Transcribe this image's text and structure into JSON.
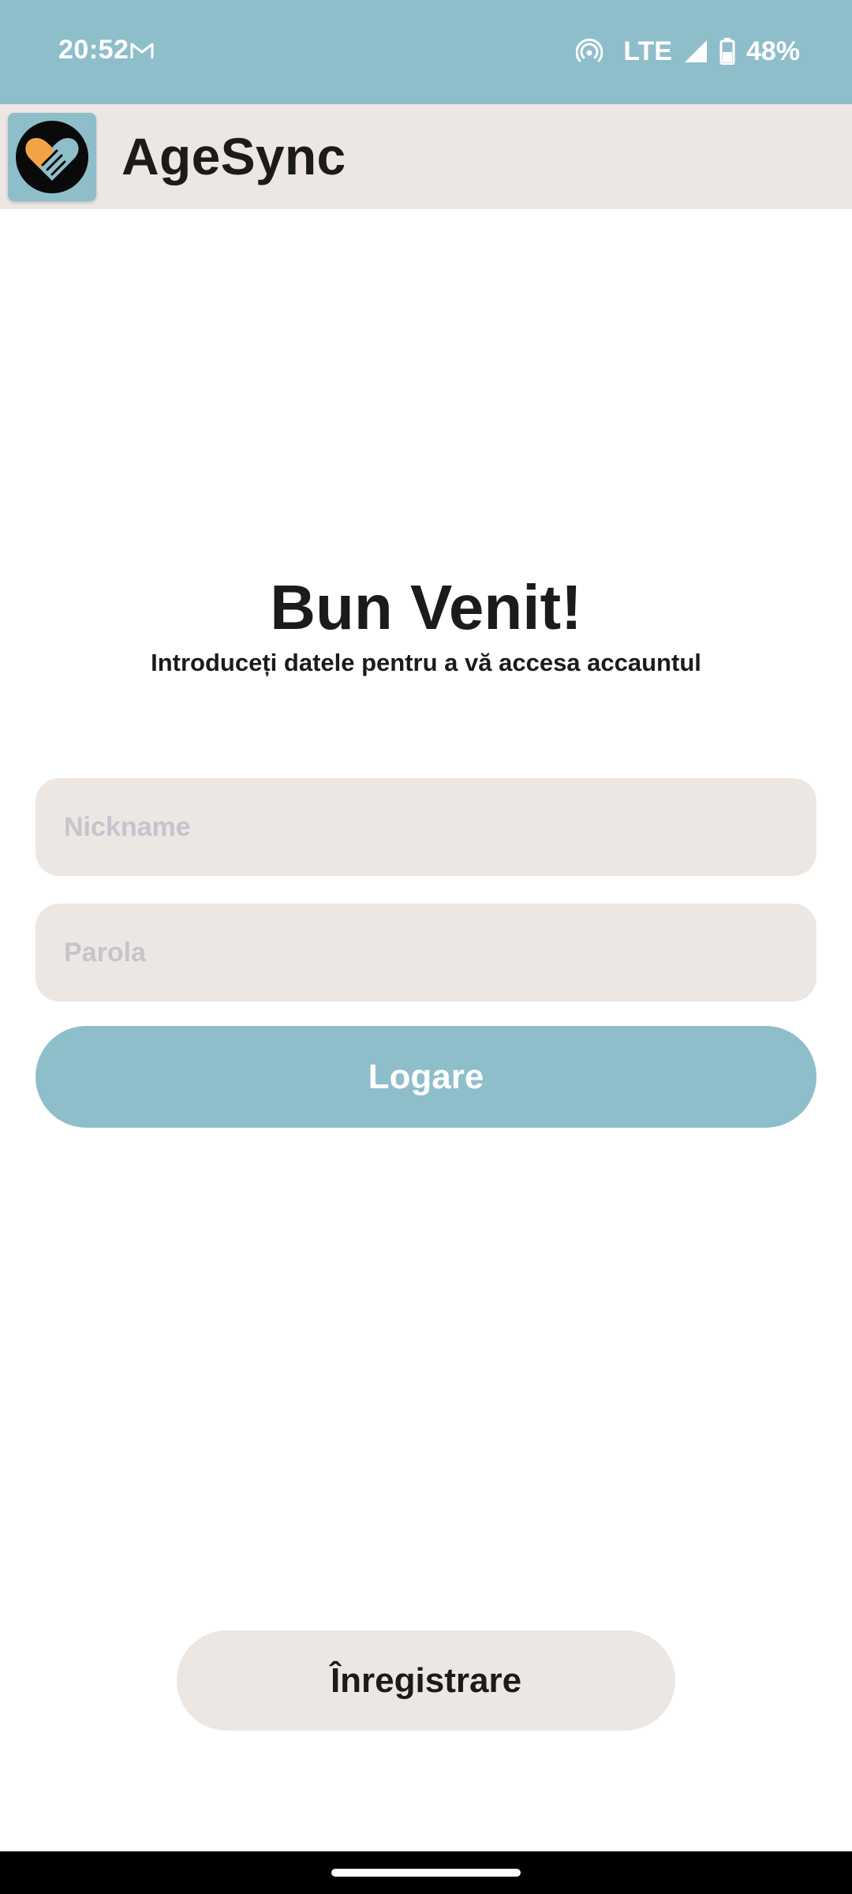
{
  "status_bar": {
    "time": "20:52",
    "network": "LTE",
    "battery": "48%",
    "icons": [
      "gmail-icon",
      "hotspot-icon",
      "signal-icon",
      "battery-icon"
    ]
  },
  "app_bar": {
    "title": "AgeSync",
    "logo_icon": "handshake-heart-icon"
  },
  "welcome": {
    "title": "Bun Venit!",
    "subtitle": "Introduceți datele pentru a vă accesa accauntul"
  },
  "form": {
    "nickname_placeholder": "Nickname",
    "nickname_value": "",
    "password_placeholder": "Parola",
    "password_value": "",
    "login_label": "Logare"
  },
  "register_label": "Înregistrare",
  "colors": {
    "accent": "#8fbecb",
    "surface": "#ece7e3",
    "text": "#1b1b1b",
    "placeholder": "#c9c2cc",
    "logo_orange": "#f2a444"
  }
}
